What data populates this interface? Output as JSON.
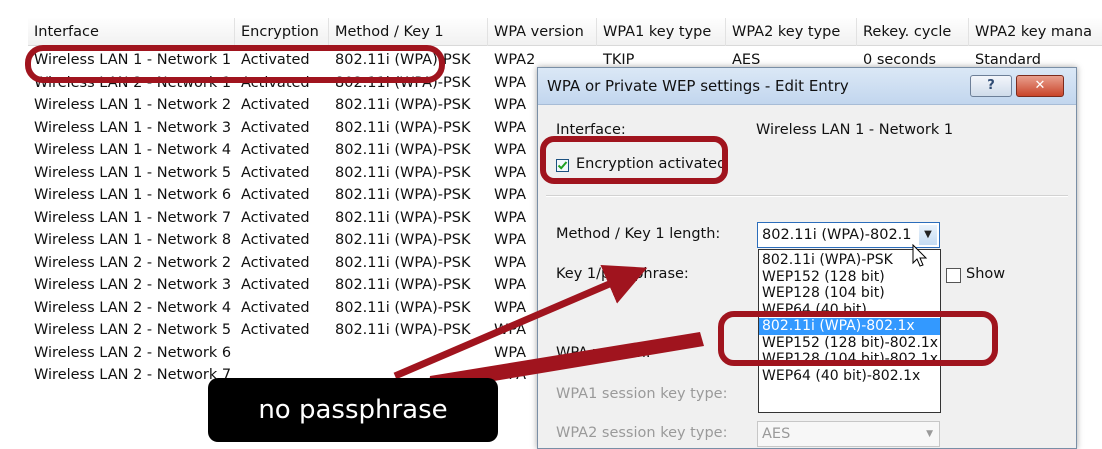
{
  "table": {
    "columns": [
      "Interface",
      "Encryption",
      "Method / Key 1",
      "WPA version",
      "WPA1 key type",
      "WPA2 key type",
      "Rekey. cycle",
      "WPA2 key mana"
    ],
    "rows": [
      [
        "Wireless LAN 1 - Network 1",
        "Activated",
        "802.11i (WPA)-PSK",
        "WPA2",
        "TKIP",
        "AES",
        "0 seconds",
        "Standard"
      ],
      [
        "Wireless LAN 2 - Network 1",
        "Activated",
        "802.11i (WPA)-PSK",
        "WPA",
        "",
        "",
        "",
        ""
      ],
      [
        "Wireless LAN 1 - Network 2",
        "Activated",
        "802.11i (WPA)-PSK",
        "WPA",
        "",
        "",
        "",
        ""
      ],
      [
        "Wireless LAN 1 - Network 3",
        "Activated",
        "802.11i (WPA)-PSK",
        "WPA",
        "",
        "",
        "",
        ""
      ],
      [
        "Wireless LAN 1 - Network 4",
        "Activated",
        "802.11i (WPA)-PSK",
        "WPA",
        "",
        "",
        "",
        ""
      ],
      [
        "Wireless LAN 1 - Network 5",
        "Activated",
        "802.11i (WPA)-PSK",
        "WPA",
        "",
        "",
        "",
        ""
      ],
      [
        "Wireless LAN 1 - Network 6",
        "Activated",
        "802.11i (WPA)-PSK",
        "WPA",
        "",
        "",
        "",
        ""
      ],
      [
        "Wireless LAN 1 - Network 7",
        "Activated",
        "802.11i (WPA)-PSK",
        "WPA",
        "",
        "",
        "",
        ""
      ],
      [
        "Wireless LAN 1 - Network 8",
        "Activated",
        "802.11i (WPA)-PSK",
        "WPA",
        "",
        "",
        "",
        ""
      ],
      [
        "Wireless LAN 2 - Network 2",
        "Activated",
        "802.11i (WPA)-PSK",
        "WPA",
        "",
        "",
        "",
        ""
      ],
      [
        "Wireless LAN 2 - Network 3",
        "Activated",
        "802.11i (WPA)-PSK",
        "WPA",
        "",
        "",
        "",
        ""
      ],
      [
        "Wireless LAN 2 - Network 4",
        "Activated",
        "802.11i (WPA)-PSK",
        "WPA",
        "",
        "",
        "",
        ""
      ],
      [
        "Wireless LAN 2 - Network 5",
        "Activated",
        "802.11i (WPA)-PSK",
        "WPA",
        "",
        "",
        "",
        ""
      ],
      [
        "Wireless LAN 2 - Network 6",
        "",
        "",
        "WPA",
        "",
        "",
        "",
        ""
      ],
      [
        "Wireless LAN 2 - Network 7",
        "",
        "",
        "WPA",
        "",
        "",
        "",
        ""
      ]
    ]
  },
  "dialog": {
    "title": "WPA or Private WEP settings - Edit Entry",
    "help_button": "?",
    "close_button": "✕",
    "interface_label": "Interface:",
    "interface_value": "Wireless LAN 1 - Network 1",
    "encryption_checkbox_label": "Encryption activated",
    "encryption_checked": true,
    "method_label": "Method / Key 1 length:",
    "method_value": "802.11i (WPA)-802.1x",
    "key_label": "Key 1/passphrase:",
    "show_label": "Show",
    "wpa_version_label": "WPA version:",
    "wpa1_label": "WPA1 session key type:",
    "wpa2_label": "WPA2 session key type:",
    "wpa2_value": "AES",
    "method_options": [
      "802.11i (WPA)-PSK",
      "WEP152 (128 bit)",
      "WEP128 (104 bit)",
      "WEP64 (40 bit)",
      "802.11i (WPA)-802.1x",
      "WEP152 (128 bit)-802.1x",
      "WEP128 (104 bit)-802.1x",
      "WEP64 (40 bit)-802.1x"
    ],
    "selected_option_index": 4
  },
  "annotation": {
    "text": "no passphrase"
  },
  "colors": {
    "highlight_ring": "#a0141e",
    "selection": "#3399ff",
    "annotation_bg": "#000000",
    "arrow": "#a0141e"
  }
}
